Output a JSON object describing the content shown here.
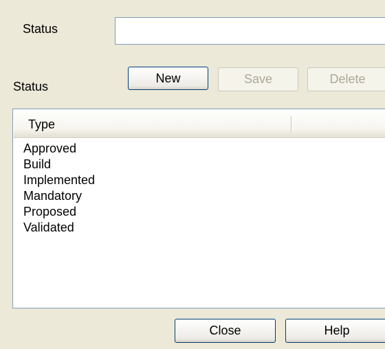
{
  "form": {
    "status_field_label": "Status",
    "status_field_value": "",
    "status_section_label": "Status"
  },
  "toolbar": {
    "new_label": "New",
    "save_label": "Save",
    "delete_label": "Delete"
  },
  "list": {
    "column_header": "Type",
    "items": [
      "Approved",
      "Build",
      "Implemented",
      "Mandatory",
      "Proposed",
      "Validated"
    ]
  },
  "footer": {
    "close_label": "Close",
    "help_label": "Help"
  }
}
